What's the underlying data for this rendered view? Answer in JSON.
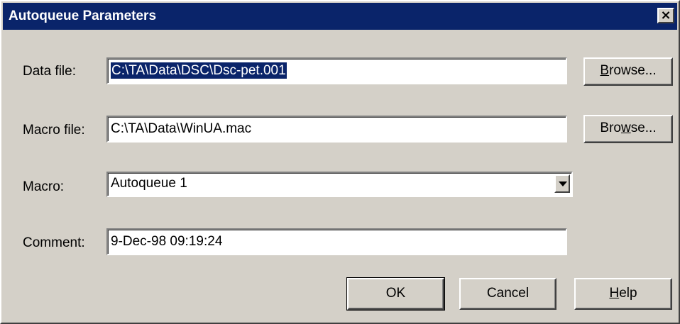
{
  "window": {
    "title": "Autoqueue Parameters",
    "close_glyph": "×",
    "close_icon": "close-icon"
  },
  "fields": {
    "data_file": {
      "label": "Data file:",
      "value": "C:\\TA\\Data\\DSC\\Dsc-pet.001",
      "selected": true
    },
    "macro_file": {
      "label": "Macro file:",
      "value": "C:\\TA\\Data\\WinUA.mac"
    },
    "macro": {
      "label": "Macro:",
      "value": "Autoqueue 1",
      "dropdown_icon": "chevron-down-icon"
    },
    "comment": {
      "label": "Comment:",
      "value": "9-Dec-98 09:19:24"
    }
  },
  "buttons": {
    "browse_data": {
      "pre": "",
      "mnemonic": "B",
      "post": "rowse..."
    },
    "browse_macro": {
      "pre": "Bro",
      "mnemonic": "w",
      "post": "se..."
    },
    "ok": "OK",
    "cancel": "Cancel",
    "help": {
      "pre": "",
      "mnemonic": "H",
      "post": "elp"
    }
  },
  "colors": {
    "titlebar": "#0a246a",
    "face": "#d4d0c8",
    "selection": "#0a246a"
  }
}
